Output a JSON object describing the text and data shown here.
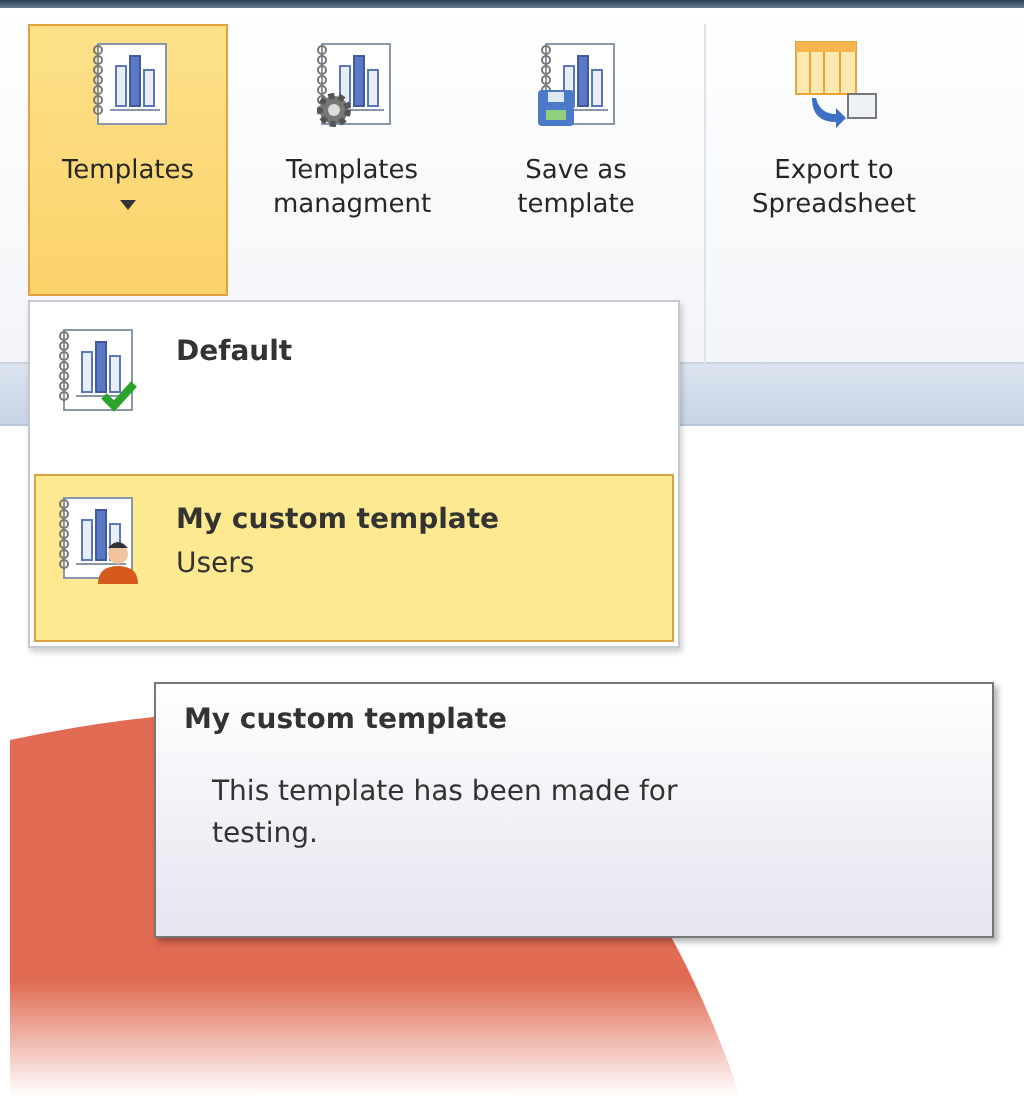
{
  "ribbon": {
    "buttons": [
      {
        "label": "Templates",
        "kind": "templates",
        "selected": true,
        "dropdown": true
      },
      {
        "label": "Templates managment",
        "kind": "manage",
        "selected": false,
        "dropdown": false
      },
      {
        "label": "Save as template",
        "kind": "save",
        "selected": false,
        "dropdown": false
      },
      {
        "label": "Export to Spreadsheet",
        "kind": "export",
        "selected": false,
        "dropdown": false
      }
    ]
  },
  "menu": {
    "items": [
      {
        "title": "Default",
        "checked": true,
        "selected": false
      },
      {
        "title": "My custom template",
        "subtitle": "Users",
        "checked": false,
        "selected": true
      }
    ]
  },
  "tooltip": {
    "title": "My custom template",
    "text": "This template has been made for testing."
  }
}
